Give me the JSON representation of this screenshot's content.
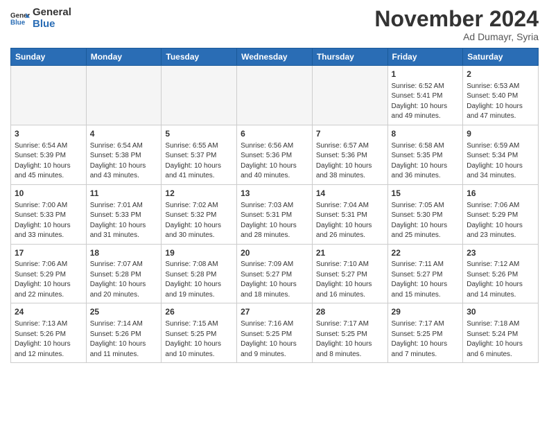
{
  "header": {
    "logo_line1": "General",
    "logo_line2": "Blue",
    "month": "November 2024",
    "location": "Ad Dumayr, Syria"
  },
  "days_of_week": [
    "Sunday",
    "Monday",
    "Tuesday",
    "Wednesday",
    "Thursday",
    "Friday",
    "Saturday"
  ],
  "weeks": [
    [
      {
        "day": "",
        "info": ""
      },
      {
        "day": "",
        "info": ""
      },
      {
        "day": "",
        "info": ""
      },
      {
        "day": "",
        "info": ""
      },
      {
        "day": "",
        "info": ""
      },
      {
        "day": "1",
        "info": "Sunrise: 6:52 AM\nSunset: 5:41 PM\nDaylight: 10 hours\nand 49 minutes."
      },
      {
        "day": "2",
        "info": "Sunrise: 6:53 AM\nSunset: 5:40 PM\nDaylight: 10 hours\nand 47 minutes."
      }
    ],
    [
      {
        "day": "3",
        "info": "Sunrise: 6:54 AM\nSunset: 5:39 PM\nDaylight: 10 hours\nand 45 minutes."
      },
      {
        "day": "4",
        "info": "Sunrise: 6:54 AM\nSunset: 5:38 PM\nDaylight: 10 hours\nand 43 minutes."
      },
      {
        "day": "5",
        "info": "Sunrise: 6:55 AM\nSunset: 5:37 PM\nDaylight: 10 hours\nand 41 minutes."
      },
      {
        "day": "6",
        "info": "Sunrise: 6:56 AM\nSunset: 5:36 PM\nDaylight: 10 hours\nand 40 minutes."
      },
      {
        "day": "7",
        "info": "Sunrise: 6:57 AM\nSunset: 5:36 PM\nDaylight: 10 hours\nand 38 minutes."
      },
      {
        "day": "8",
        "info": "Sunrise: 6:58 AM\nSunset: 5:35 PM\nDaylight: 10 hours\nand 36 minutes."
      },
      {
        "day": "9",
        "info": "Sunrise: 6:59 AM\nSunset: 5:34 PM\nDaylight: 10 hours\nand 34 minutes."
      }
    ],
    [
      {
        "day": "10",
        "info": "Sunrise: 7:00 AM\nSunset: 5:33 PM\nDaylight: 10 hours\nand 33 minutes."
      },
      {
        "day": "11",
        "info": "Sunrise: 7:01 AM\nSunset: 5:33 PM\nDaylight: 10 hours\nand 31 minutes."
      },
      {
        "day": "12",
        "info": "Sunrise: 7:02 AM\nSunset: 5:32 PM\nDaylight: 10 hours\nand 30 minutes."
      },
      {
        "day": "13",
        "info": "Sunrise: 7:03 AM\nSunset: 5:31 PM\nDaylight: 10 hours\nand 28 minutes."
      },
      {
        "day": "14",
        "info": "Sunrise: 7:04 AM\nSunset: 5:31 PM\nDaylight: 10 hours\nand 26 minutes."
      },
      {
        "day": "15",
        "info": "Sunrise: 7:05 AM\nSunset: 5:30 PM\nDaylight: 10 hours\nand 25 minutes."
      },
      {
        "day": "16",
        "info": "Sunrise: 7:06 AM\nSunset: 5:29 PM\nDaylight: 10 hours\nand 23 minutes."
      }
    ],
    [
      {
        "day": "17",
        "info": "Sunrise: 7:06 AM\nSunset: 5:29 PM\nDaylight: 10 hours\nand 22 minutes."
      },
      {
        "day": "18",
        "info": "Sunrise: 7:07 AM\nSunset: 5:28 PM\nDaylight: 10 hours\nand 20 minutes."
      },
      {
        "day": "19",
        "info": "Sunrise: 7:08 AM\nSunset: 5:28 PM\nDaylight: 10 hours\nand 19 minutes."
      },
      {
        "day": "20",
        "info": "Sunrise: 7:09 AM\nSunset: 5:27 PM\nDaylight: 10 hours\nand 18 minutes."
      },
      {
        "day": "21",
        "info": "Sunrise: 7:10 AM\nSunset: 5:27 PM\nDaylight: 10 hours\nand 16 minutes."
      },
      {
        "day": "22",
        "info": "Sunrise: 7:11 AM\nSunset: 5:27 PM\nDaylight: 10 hours\nand 15 minutes."
      },
      {
        "day": "23",
        "info": "Sunrise: 7:12 AM\nSunset: 5:26 PM\nDaylight: 10 hours\nand 14 minutes."
      }
    ],
    [
      {
        "day": "24",
        "info": "Sunrise: 7:13 AM\nSunset: 5:26 PM\nDaylight: 10 hours\nand 12 minutes."
      },
      {
        "day": "25",
        "info": "Sunrise: 7:14 AM\nSunset: 5:26 PM\nDaylight: 10 hours\nand 11 minutes."
      },
      {
        "day": "26",
        "info": "Sunrise: 7:15 AM\nSunset: 5:25 PM\nDaylight: 10 hours\nand 10 minutes."
      },
      {
        "day": "27",
        "info": "Sunrise: 7:16 AM\nSunset: 5:25 PM\nDaylight: 10 hours\nand 9 minutes."
      },
      {
        "day": "28",
        "info": "Sunrise: 7:17 AM\nSunset: 5:25 PM\nDaylight: 10 hours\nand 8 minutes."
      },
      {
        "day": "29",
        "info": "Sunrise: 7:17 AM\nSunset: 5:25 PM\nDaylight: 10 hours\nand 7 minutes."
      },
      {
        "day": "30",
        "info": "Sunrise: 7:18 AM\nSunset: 5:24 PM\nDaylight: 10 hours\nand 6 minutes."
      }
    ]
  ]
}
